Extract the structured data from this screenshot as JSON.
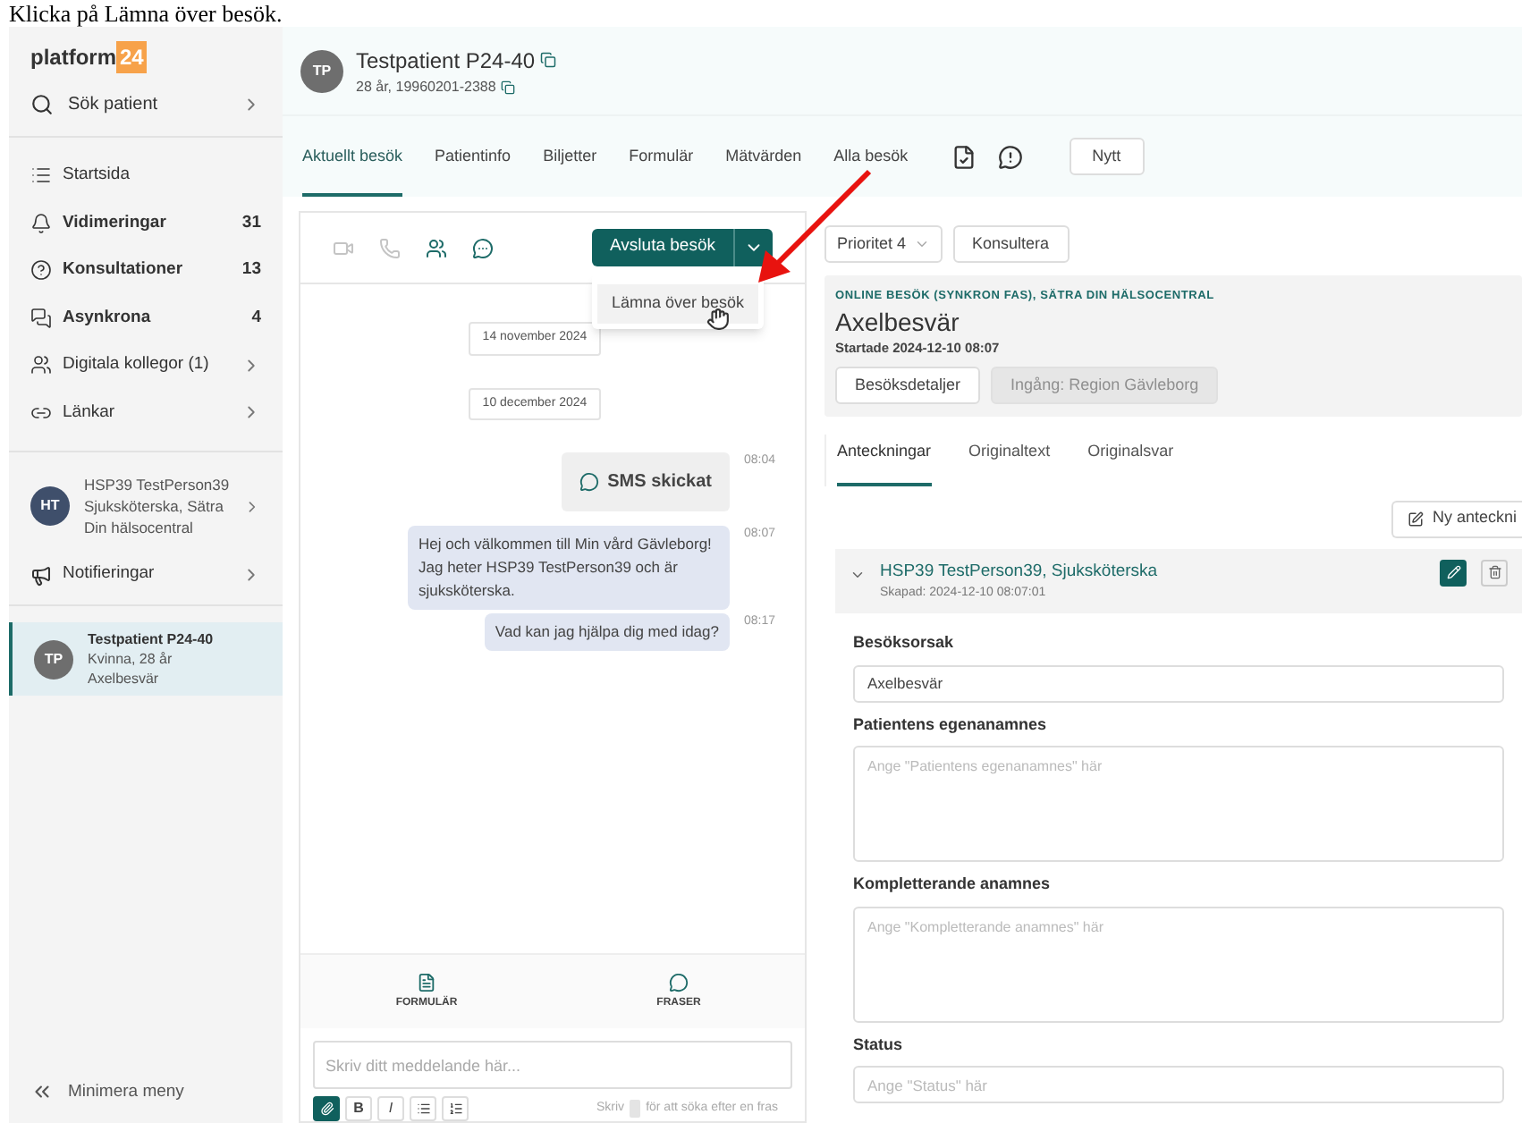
{
  "caption": "Klicka på Lämna över besök.",
  "sidebar": {
    "logo_word": "platform",
    "logo_number": "24",
    "search": "Sök patient",
    "items": [
      {
        "label": "Startsida"
      },
      {
        "label": "Vidimeringar",
        "count": "31"
      },
      {
        "label": "Konsultationer",
        "count": "13"
      },
      {
        "label": "Asynkrona",
        "count": "4"
      },
      {
        "label": "Digitala kollegor (1)",
        "chevron": true
      },
      {
        "label": "Länkar",
        "chevron": true
      }
    ],
    "user": {
      "initials": "HT",
      "name": "HSP39 TestPerson39",
      "role": "Sjuksköterska, Sätra Din hälsocentral"
    },
    "notifications": "Notifieringar",
    "patients": [
      {
        "initials": "TP",
        "name": "Testpatient P24-40",
        "info": "Kvinna, 28 år",
        "reason": "Axelbesvär",
        "selected": true
      }
    ],
    "collapse": "Minimera meny"
  },
  "patient": {
    "initials": "TP",
    "name": "Testpatient P24-40",
    "details": "28 år, 19960201-2388"
  },
  "tabs": [
    {
      "label": "Aktuellt besök",
      "selected": true
    },
    {
      "label": "Patientinfo",
      "selected": false
    },
    {
      "label": "Biljetter",
      "selected": false
    },
    {
      "label": "Formulär",
      "selected": false
    },
    {
      "label": "Mätvärden",
      "selected": false
    },
    {
      "label": "Alla besök",
      "selected": false
    }
  ],
  "new_button": "Nytt",
  "chat": {
    "call_controls": [
      {
        "disabled": true
      },
      {
        "disabled": true
      },
      {
        "disabled": false
      },
      {
        "disabled": false
      }
    ],
    "end_button": "Avsluta besök",
    "menu_item": "Lämna över besök",
    "messages": [
      {
        "kind": "date",
        "text": "14 november 2024"
      },
      {
        "kind": "date",
        "text": "10 december 2024"
      },
      {
        "kind": "system",
        "text": "SMS skickat",
        "time": "08:04"
      },
      {
        "kind": "outgoing",
        "text": "Hej och välkommen till Min vård Gävleborg! Jag heter HSP39 TestPerson39 och är sjuksköterska.",
        "time": "08:07"
      },
      {
        "kind": "outgoing",
        "text": "Vad kan jag hjälpa dig med idag?",
        "time": "08:17"
      }
    ],
    "shortcuts": [
      "FORMULÄR",
      "FRASER"
    ],
    "placeholder": "Skriv ditt meddelande här...",
    "format_buttons": [
      {
        "kind": "icon",
        "selected": true
      },
      {
        "kind": "text",
        "text": "B",
        "selected": false
      },
      {
        "kind": "text",
        "text": "I",
        "selected": false
      },
      {
        "kind": "icon",
        "selected": false
      },
      {
        "kind": "icon",
        "selected": false
      }
    ],
    "hint_before": "Skriv",
    "hint_after": "för att söka efter en fras"
  },
  "visit": {
    "priority": "Prioritet 4",
    "consult": "Konsultera",
    "type": "ONLINE BESÖK (SYNKRON FAS), SÄTRA DIN HÄLSOCENTRAL",
    "title": "Axelbesvär",
    "started": "Startade 2024-12-10 08:07",
    "buttons": [
      {
        "label": "Besöksdetaljer",
        "disabled": false
      },
      {
        "label": "Ingång: Region Gävleborg",
        "disabled": true
      }
    ],
    "tabs": [
      {
        "label": "Anteckningar",
        "selected": true
      },
      {
        "label": "Originaltext",
        "selected": false
      },
      {
        "label": "Originalsvar",
        "selected": false
      }
    ],
    "new_note": "Ny anteckni",
    "note": {
      "author": "HSP39 TestPerson39, Sjuksköterska",
      "created": "Skapad: 2024-12-10 08:07:01",
      "expanded": true
    },
    "fields": [
      {
        "label": "Besöksorsak",
        "value": "Axelbesvär",
        "kind": "line"
      },
      {
        "label": "Patientens egenanamnes",
        "placeholder": "Ange \"Patientens egenanamnes\" här",
        "kind": "area"
      },
      {
        "label": "Kompletterande anamnes",
        "placeholder": "Ange \"Kompletterande anamnes\" här",
        "kind": "area"
      },
      {
        "label": "Status",
        "placeholder": "Ange \"Status\" här",
        "kind": "line"
      }
    ]
  }
}
